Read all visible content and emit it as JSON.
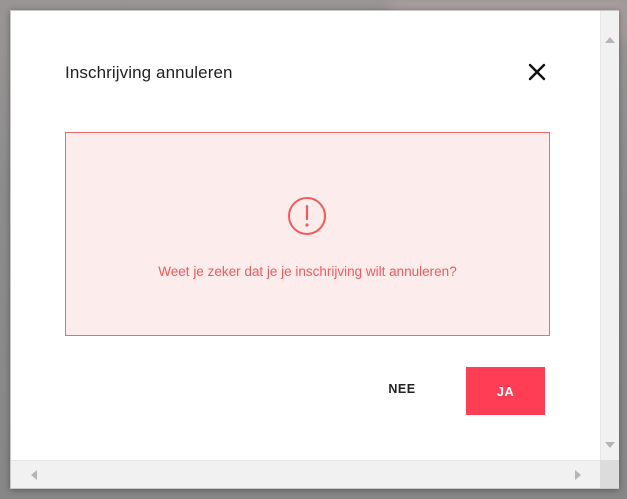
{
  "dialog": {
    "title": "Inschrijving annuleren",
    "close_icon": "close-icon"
  },
  "alert": {
    "icon": "exclamation-circle-icon",
    "message": "Weet je zeker dat je je inschrijving wilt annuleren?"
  },
  "actions": {
    "no_label": "NEE",
    "yes_label": "JA"
  },
  "colors": {
    "accent": "#ff3d54",
    "alert_border": "#f06a6a",
    "alert_background": "#fdecec",
    "alert_text": "#ef5a5a",
    "title_text": "#222222"
  }
}
